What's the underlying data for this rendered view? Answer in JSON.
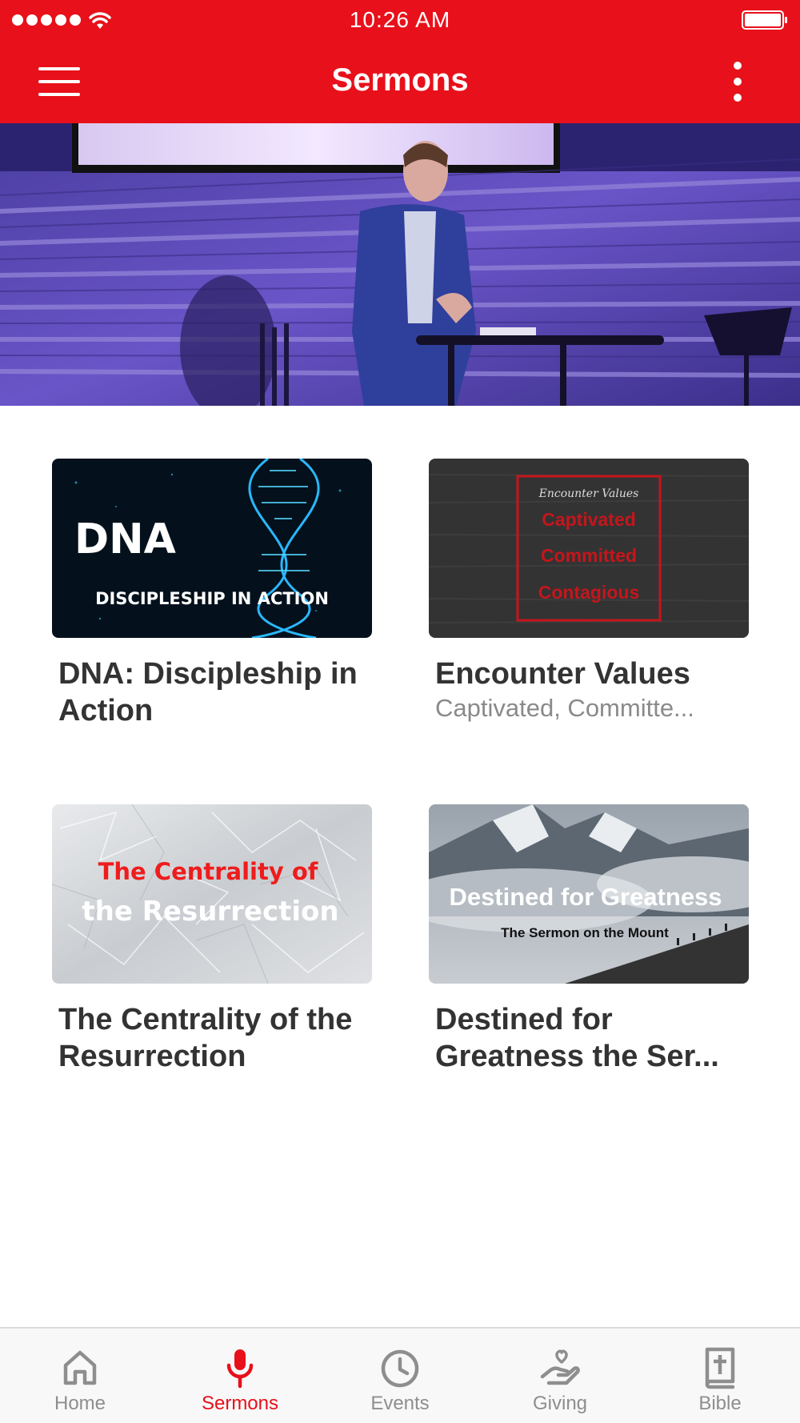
{
  "status_bar": {
    "time": "10:26 AM"
  },
  "header": {
    "title": "Sermons",
    "background_color": "#e8101a",
    "menu_icon": "hamburger-menu-icon",
    "more_icon": "more-vertical-icon"
  },
  "hero": {
    "image": "pastor-preaching-stage-photo"
  },
  "sermons": [
    {
      "title": "DNA: Discipleship in Action",
      "subtitle": "",
      "thumbnail": {
        "heading": "DNA",
        "caption": "DISCIPLESHIP IN ACTION",
        "image": "dna-helix-artwork"
      }
    },
    {
      "title": "Encounter Values",
      "subtitle": "Captivated, Committe...",
      "thumbnail": {
        "heading": "Encounter Values",
        "lines": [
          "Captivated",
          "Committed",
          "Contagious"
        ],
        "image": "wood-texture-framed-text"
      }
    },
    {
      "title": "The Centrality of the Resurrection",
      "subtitle": "",
      "thumbnail": {
        "line1": "The Centrality of",
        "line2": "the Resurrection",
        "image": "frost-texture-artwork"
      }
    },
    {
      "title": "Destined for Greatness the Ser...",
      "subtitle": "",
      "thumbnail": {
        "heading": "Destined for Greatness",
        "caption": "The Sermon on the Mount",
        "image": "mountain-climbers-artwork"
      }
    }
  ],
  "tabs": [
    {
      "label": "Home",
      "icon": "home-icon",
      "active": false
    },
    {
      "label": "Sermons",
      "icon": "microphone-icon",
      "active": true
    },
    {
      "label": "Events",
      "icon": "clock-icon",
      "active": false
    },
    {
      "label": "Giving",
      "icon": "giving-hand-icon",
      "active": false
    },
    {
      "label": "Bible",
      "icon": "bible-icon",
      "active": false
    }
  ],
  "colors": {
    "accent": "#e8101a",
    "tab_inactive": "#8e8e8e",
    "text": "#333333",
    "subtitle": "#8a8a8a"
  }
}
